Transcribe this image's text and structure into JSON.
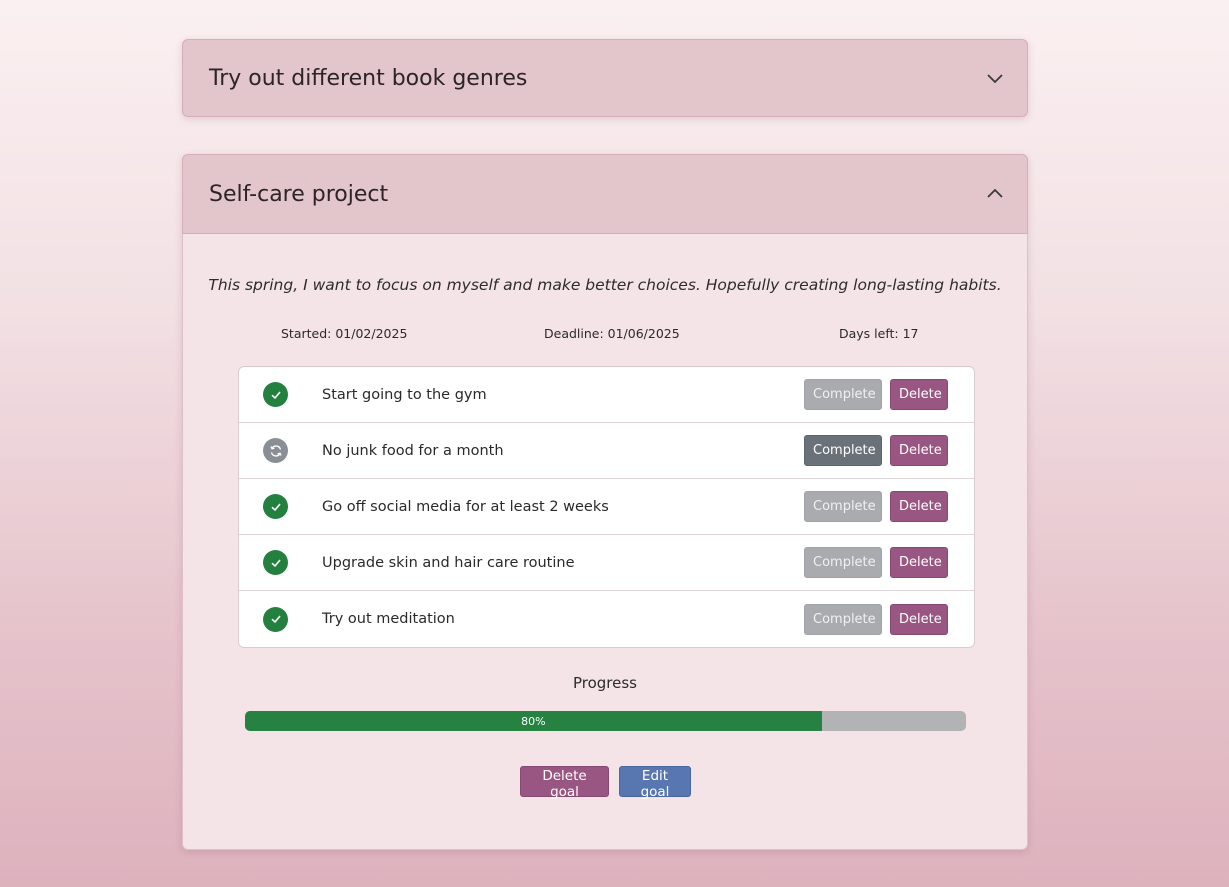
{
  "goals": [
    {
      "title": "Try out different book genres",
      "expanded": false
    },
    {
      "title": "Self-care project",
      "expanded": true,
      "description": "This spring, I want to focus on myself and make better choices. Hopefully creating long-lasting habits.",
      "started": "Started: 01/02/2025",
      "deadline": "Deadline: 01/06/2025",
      "days_left": "Days left: 17",
      "tasks": [
        {
          "text": "Start going to the gym",
          "status": "completed"
        },
        {
          "text": "No junk food for a month",
          "status": "in-progress"
        },
        {
          "text": "Go off social media for at least 2 weeks",
          "status": "completed"
        },
        {
          "text": "Upgrade skin and hair care routine",
          "status": "completed"
        },
        {
          "text": "Try out meditation",
          "status": "completed"
        }
      ],
      "progress_label": "Progress",
      "progress_percent": 80,
      "progress_text": "80%"
    }
  ],
  "buttons": {
    "complete": "Complete",
    "delete": "Delete",
    "delete_goal": "Delete goal",
    "edit_goal": "Edit goal"
  },
  "colors": {
    "completed": "#23803f",
    "in_progress": "#8a8f95",
    "delete": "#995683",
    "edit": "#5877b0"
  }
}
